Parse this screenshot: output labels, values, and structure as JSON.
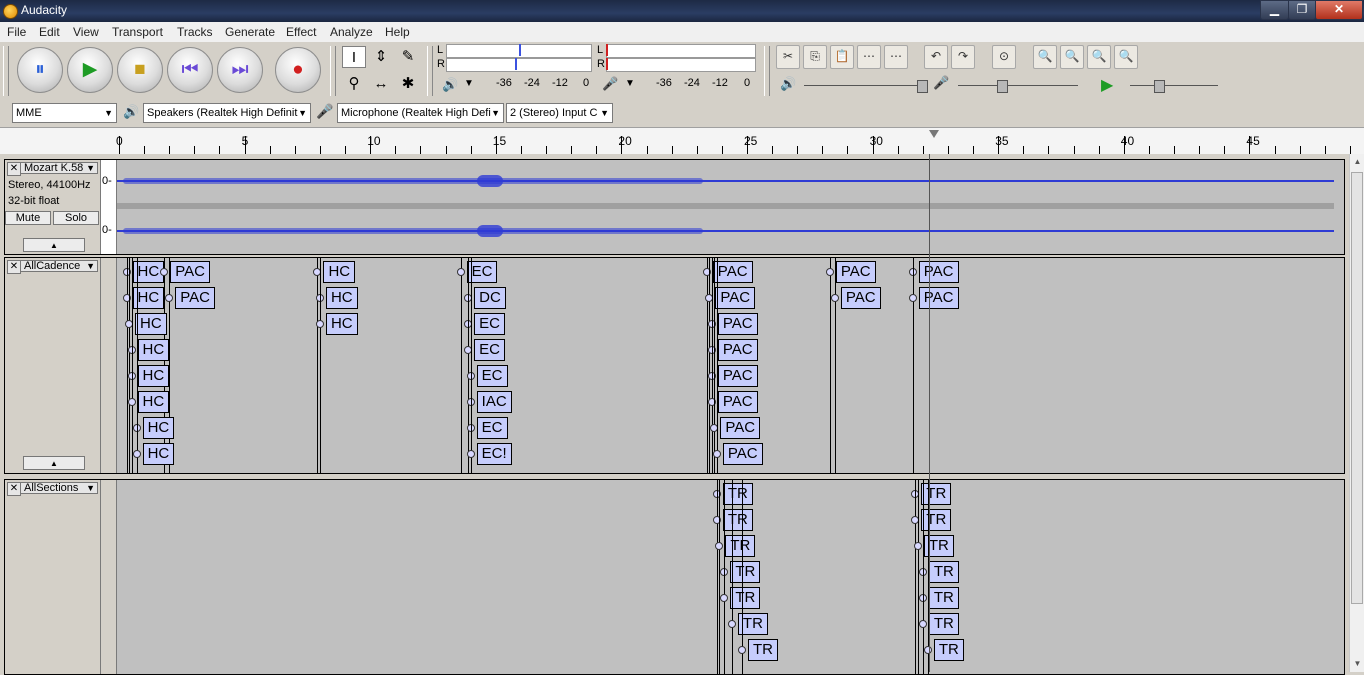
{
  "window": {
    "title": "Audacity",
    "minimize": "▁",
    "maximize": "❐",
    "close": "✕"
  },
  "menu": [
    "File",
    "Edit",
    "View",
    "Transport",
    "Tracks",
    "Generate",
    "Effect",
    "Analyze",
    "Help"
  ],
  "meter": {
    "left_channel": "L",
    "right_channel": "R",
    "ticks": [
      "-36",
      "-24",
      "-12",
      "0"
    ]
  },
  "devices": {
    "host": "MME",
    "output": "Speakers (Realtek High Definit",
    "input": "Microphone (Realtek High Defi",
    "channels": "2 (Stereo) Input C"
  },
  "ruler": {
    "labels": [
      "0",
      "5",
      "10",
      "15",
      "20",
      "25",
      "30",
      "35",
      "40",
      "45"
    ]
  },
  "tracks": {
    "audio": {
      "name": "Mozart K.58",
      "format": "Stereo, 44100Hz",
      "bitdepth": "32-bit float",
      "mute": "Mute",
      "solo": "Solo",
      "zero_label": "0-"
    },
    "cadence": {
      "name": "AllCadence",
      "labels": [
        {
          "text": "HC",
          "t": 0.3,
          "row": 0
        },
        {
          "text": "PAC",
          "t": 1.8,
          "row": 0
        },
        {
          "text": "HC",
          "t": 0.3,
          "row": 1
        },
        {
          "text": "PAC",
          "t": 2.0,
          "row": 1
        },
        {
          "text": "HC",
          "t": 0.4,
          "row": 2
        },
        {
          "text": "HC",
          "t": 0.5,
          "row": 3
        },
        {
          "text": "HC",
          "t": 0.5,
          "row": 4
        },
        {
          "text": "HC",
          "t": 0.5,
          "row": 5
        },
        {
          "text": "HC",
          "t": 0.7,
          "row": 6
        },
        {
          "text": "HC",
          "t": 0.7,
          "row": 7
        },
        {
          "text": "HC",
          "t": 7.9,
          "row": 0
        },
        {
          "text": "HC",
          "t": 8.0,
          "row": 1
        },
        {
          "text": "HC",
          "t": 8.0,
          "row": 2
        },
        {
          "text": "EC",
          "t": 13.6,
          "row": 0
        },
        {
          "text": "DC",
          "t": 13.9,
          "row": 1
        },
        {
          "text": "EC",
          "t": 13.9,
          "row": 2
        },
        {
          "text": "EC",
          "t": 13.9,
          "row": 3
        },
        {
          "text": "EC",
          "t": 14.0,
          "row": 4
        },
        {
          "text": "IAC",
          "t": 14.0,
          "row": 5
        },
        {
          "text": "EC",
          "t": 14.0,
          "row": 6
        },
        {
          "text": "EC!",
          "t": 14.0,
          "row": 7
        },
        {
          "text": "PAC",
          "t": 23.4,
          "row": 0
        },
        {
          "text": "PAC",
          "t": 23.5,
          "row": 1
        },
        {
          "text": "PAC",
          "t": 23.6,
          "row": 2
        },
        {
          "text": "PAC",
          "t": 23.6,
          "row": 3
        },
        {
          "text": "PAC",
          "t": 23.6,
          "row": 4
        },
        {
          "text": "PAC",
          "t": 23.6,
          "row": 5
        },
        {
          "text": "PAC",
          "t": 23.7,
          "row": 6
        },
        {
          "text": "PAC",
          "t": 23.8,
          "row": 7
        },
        {
          "text": "PAC",
          "t": 28.3,
          "row": 0
        },
        {
          "text": "PAC",
          "t": 28.5,
          "row": 1
        },
        {
          "text": "PAC",
          "t": 31.6,
          "row": 0
        },
        {
          "text": "PAC",
          "t": 31.6,
          "row": 1
        }
      ]
    },
    "sections": {
      "name": "AllSections",
      "labels": [
        {
          "text": "TR",
          "t": 23.8,
          "row": 0
        },
        {
          "text": "TR",
          "t": 23.8,
          "row": 1
        },
        {
          "text": "TR",
          "t": 23.9,
          "row": 2
        },
        {
          "text": "TR",
          "t": 24.1,
          "row": 3
        },
        {
          "text": "TR",
          "t": 24.1,
          "row": 4
        },
        {
          "text": "TR",
          "t": 24.4,
          "row": 5
        },
        {
          "text": "TR",
          "t": 24.8,
          "row": 6
        },
        {
          "text": "TR",
          "t": 31.7,
          "row": 0
        },
        {
          "text": "TR",
          "t": 31.7,
          "row": 1
        },
        {
          "text": "TR",
          "t": 31.8,
          "row": 2
        },
        {
          "text": "TR",
          "t": 32.0,
          "row": 3
        },
        {
          "text": "TR",
          "t": 32.0,
          "row": 4
        },
        {
          "text": "TR",
          "t": 32.0,
          "row": 5
        },
        {
          "text": "TR",
          "t": 32.2,
          "row": 6
        }
      ]
    }
  },
  "colors": {
    "waveform": "#2e3bd4",
    "label_fill": "#c6cdfc",
    "track_bg": "#c0c0c0"
  },
  "icons": {
    "pause": "⏸",
    "play": "▶",
    "stop": "■",
    "skip_start": "⏮",
    "skip_end": "⏭",
    "record": "●",
    "select": "I",
    "envelope": "⇕",
    "draw": "✎",
    "zoom": "⚲",
    "timeshift": "↔",
    "multi": "✱",
    "speaker": "🔊",
    "mic": "🎤"
  },
  "edit_icons": [
    "✂",
    "⎘",
    "📋",
    "⋯",
    "⋯",
    "↶",
    "↷",
    "⊙",
    "🔍",
    "🔍",
    "🔍",
    "🔍"
  ]
}
